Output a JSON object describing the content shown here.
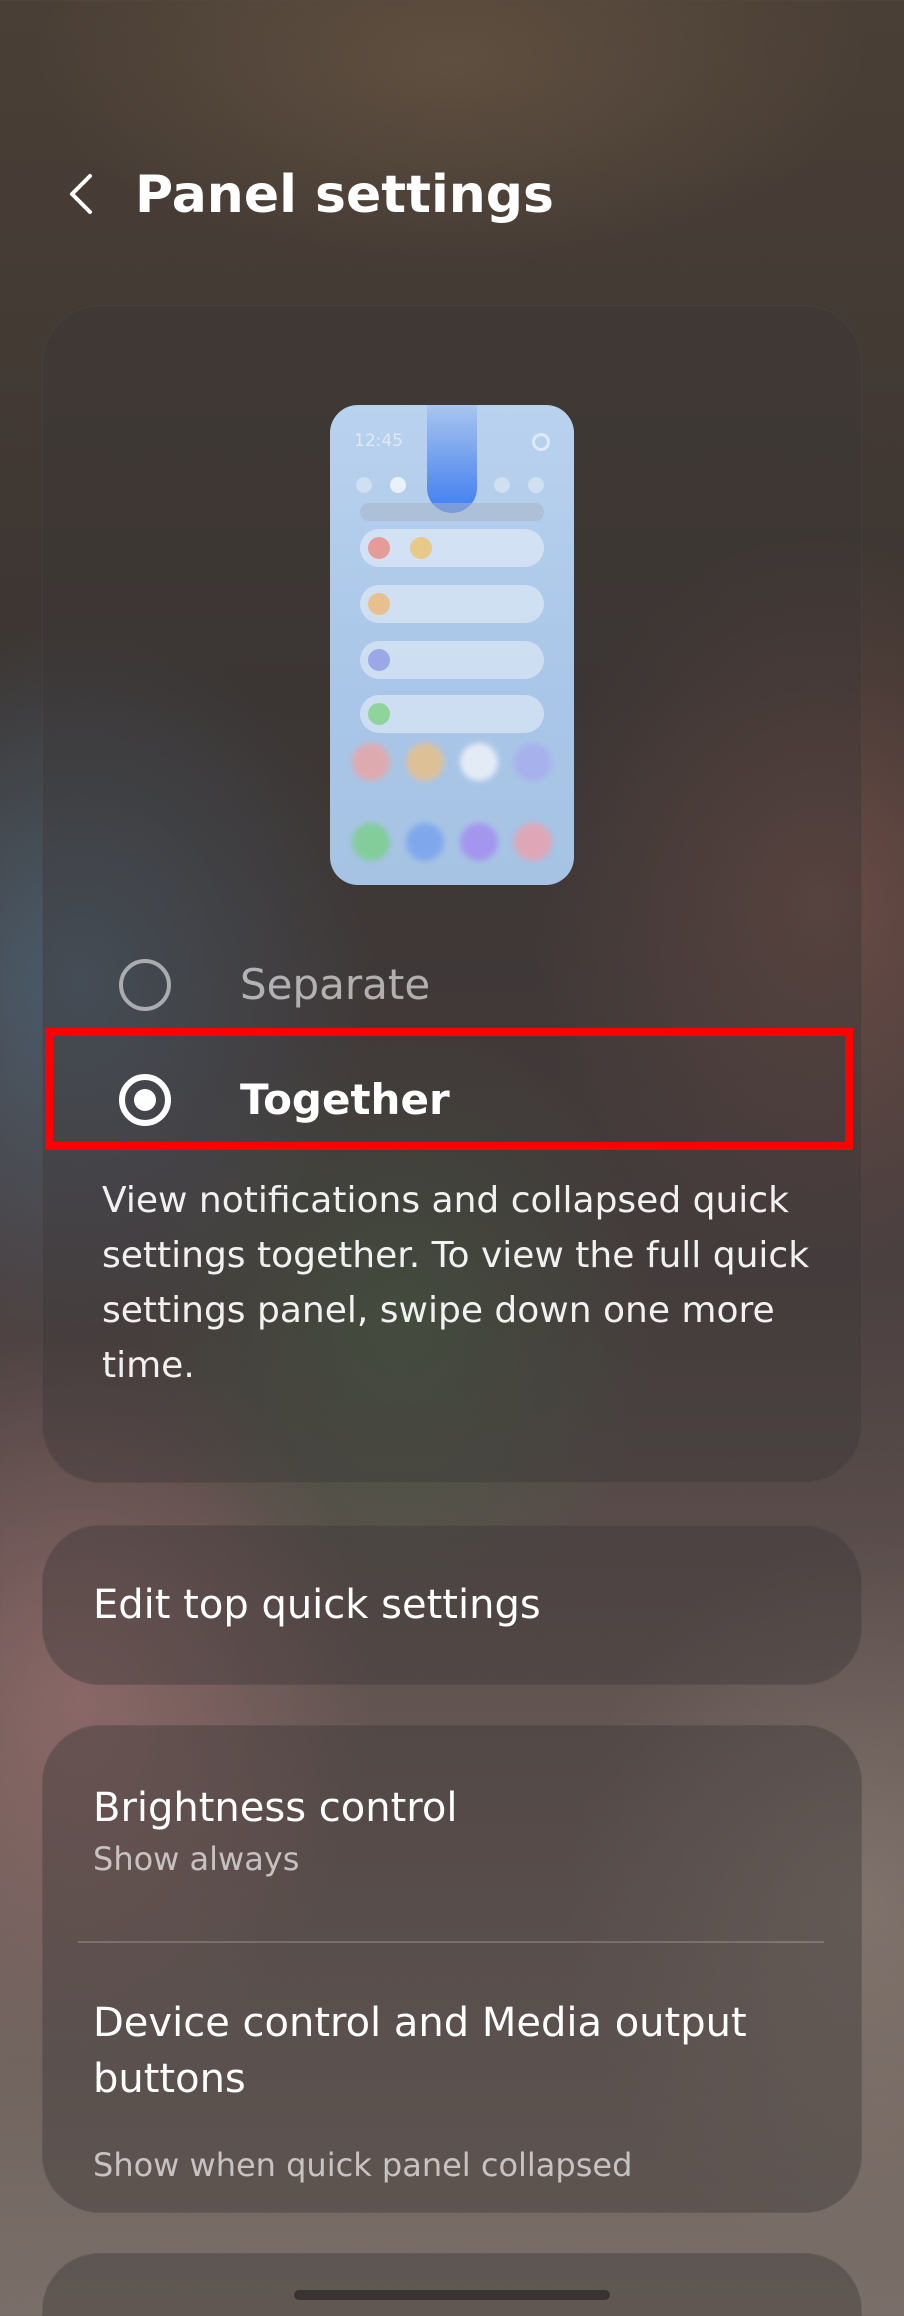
{
  "header": {
    "title": "Panel settings",
    "back_icon": "chevron-left-icon"
  },
  "panel_style": {
    "preview": {
      "time": "12:45"
    },
    "options": [
      {
        "label": "Separate",
        "selected": false
      },
      {
        "label": "Together",
        "selected": true
      }
    ],
    "description": "View notifications and collapsed quick settings together. To view the full quick settings panel, swipe down one more time.",
    "highlight_color": "#ff0000"
  },
  "edit_quick_settings": {
    "label": "Edit top quick settings"
  },
  "controls": {
    "brightness": {
      "title": "Brightness control",
      "subtitle": "Show always"
    },
    "device_media": {
      "title": "Device control and Media output buttons",
      "subtitle": "Show when quick panel collapsed"
    }
  }
}
